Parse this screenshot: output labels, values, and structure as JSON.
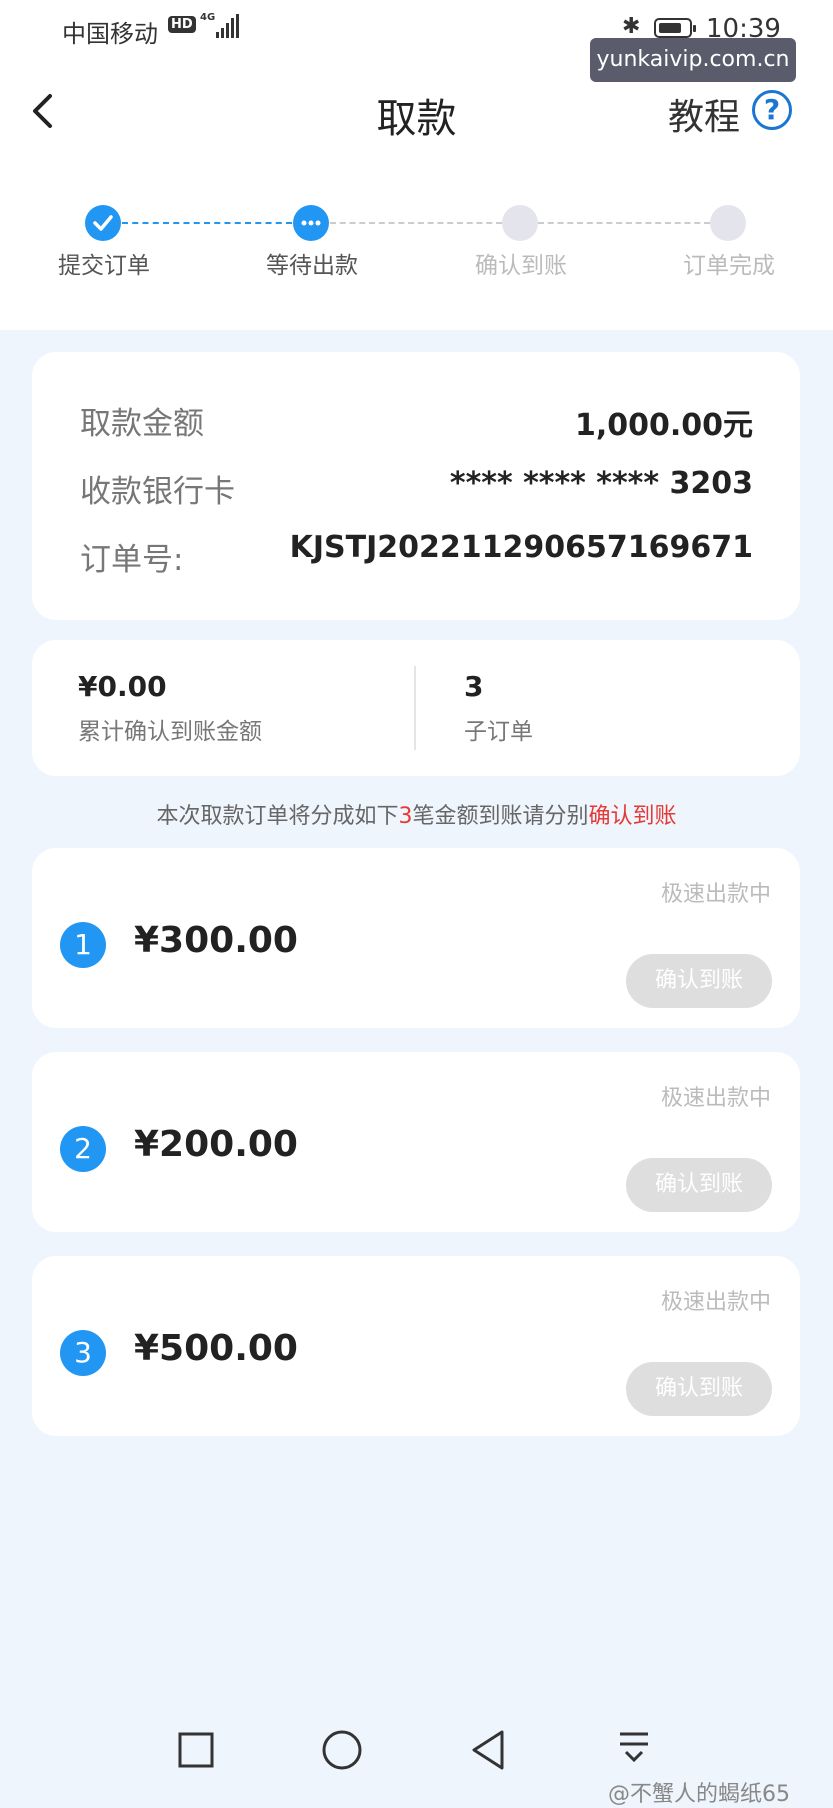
{
  "status_bar": {
    "carrier": "中国移动",
    "hd": "HD",
    "network": "4G",
    "time": "10:39"
  },
  "watermark": "yunkaivip.com.cn",
  "header": {
    "title": "取款",
    "tutorial": "教程",
    "help": "?"
  },
  "steps": [
    {
      "label": "提交订单",
      "state": "done"
    },
    {
      "label": "等待出款",
      "state": "current"
    },
    {
      "label": "确认到账",
      "state": "pending"
    },
    {
      "label": "订单完成",
      "state": "pending"
    }
  ],
  "info": {
    "amount_label": "取款金额",
    "amount_value": "1,000.00元",
    "card_label": "收款银行卡",
    "card_value": "**** **** **** 3203",
    "order_label": "订单号:",
    "order_value": "KJSTJ2022112906571696​71"
  },
  "stats": {
    "confirmed_value": "¥0.00",
    "confirmed_label": "累计确认到账金额",
    "sub_count": "3",
    "sub_label": "子订单"
  },
  "notice": {
    "prefix": "本次取款订单将分成如下",
    "count": "3",
    "middle": "笔金额到账请分别",
    "link": "确认到账"
  },
  "sub_orders": [
    {
      "index": "1",
      "amount": "¥300.00",
      "status": "极速出款中",
      "button": "确认到账"
    },
    {
      "index": "2",
      "amount": "¥200.00",
      "status": "极速出款中",
      "button": "确认到账"
    },
    {
      "index": "3",
      "amount": "¥500.00",
      "status": "极速出款中",
      "button": "确认到账"
    }
  ],
  "credit": "@不蟹人的蝎纸65",
  "colors": {
    "primary": "#2196f3",
    "accent_red": "#e53935",
    "background": "#eef5fd",
    "button_disabled": "#dedede"
  }
}
